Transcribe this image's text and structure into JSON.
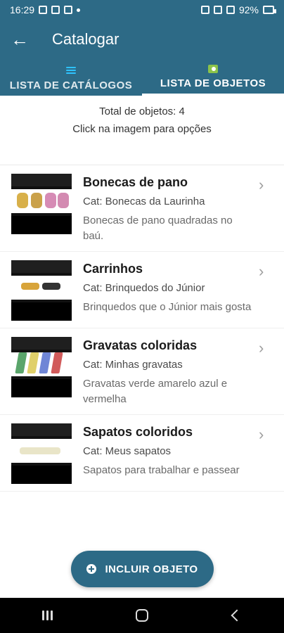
{
  "status_bar": {
    "time": "16:29",
    "battery": "92%"
  },
  "app_bar": {
    "title": "Catalogar",
    "back_icon": "arrow-left"
  },
  "tabs": [
    {
      "label": "LISTA DE CATÁLOGOS",
      "icon": "list-icon",
      "active": false
    },
    {
      "label": "LISTA DE OBJETOS",
      "icon": "camera-icon",
      "active": true
    }
  ],
  "summary": {
    "total": "Total de objetos: 4",
    "hint": "Click na imagem para opções"
  },
  "items": [
    {
      "title": "Bonecas de pano",
      "category": "Cat: Bonecas da Laurinha",
      "description": "Bonecas de pano quadradas no baú."
    },
    {
      "title": "Carrinhos",
      "category": "Cat: Brinquedos do Júnior",
      "description": "Brinquedos que o Júnior mais gosta"
    },
    {
      "title": "Gravatas coloridas",
      "category": "Cat: Minhas gravatas",
      "description": "Gravatas verde amarelo azul e vermelha"
    },
    {
      "title": "Sapatos coloridos",
      "category": "Cat: Meus sapatos",
      "description": "Sapatos para trabalhar e passear"
    }
  ],
  "fab": {
    "label": "INCLUIR OBJETO",
    "icon": "plus-circle-icon"
  },
  "colors": {
    "primary": "#2d6a86",
    "accent_blue": "#2ec3ff",
    "accent_green": "#8bc34a"
  }
}
